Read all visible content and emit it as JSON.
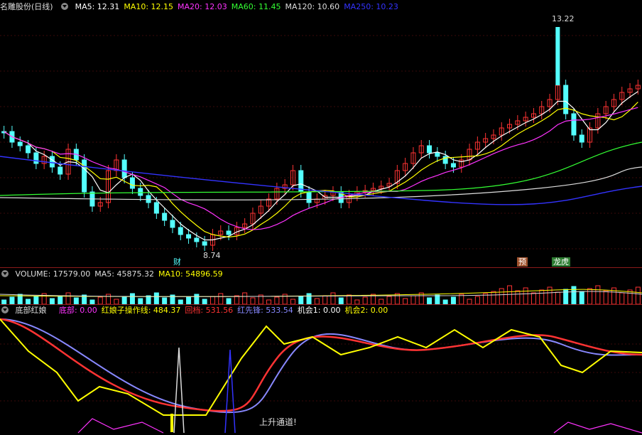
{
  "price_header": {
    "name": "名雕股份(日线)",
    "ma": [
      {
        "text": "MA5: 12.31",
        "color": "#ffffff"
      },
      {
        "text": "MA10: 12.15",
        "color": "#ffff00"
      },
      {
        "text": "MA20: 12.03",
        "color": "#ff33ff"
      },
      {
        "text": "MA60: 11.45",
        "color": "#33ff33"
      },
      {
        "text": "MA120: 10.60",
        "color": "#dddddd"
      },
      {
        "text": "MA250: 10.23",
        "color": "#3333ff"
      }
    ]
  },
  "price_labels": {
    "high": "13.22",
    "low": "8.74"
  },
  "event_tags": {
    "cai": "财",
    "yu": "预",
    "longhu": "龙虎"
  },
  "volume_header": {
    "items": [
      {
        "text": "VOLUME: 17579.00",
        "color": "#dddddd"
      },
      {
        "text": "MA5: 45875.32",
        "color": "#dddddd"
      },
      {
        "text": "MA10: 54896.59",
        "color": "#ffff00"
      }
    ]
  },
  "indicator_header": {
    "name": "底部红娘",
    "items": [
      {
        "text": "底部: 0.00",
        "color": "#ff33ff"
      },
      {
        "text": "红娘子操作线: 484.37",
        "color": "#ffff00"
      },
      {
        "text": "回档: 531.56",
        "color": "#ff3333"
      },
      {
        "text": "红先锋: 533.54",
        "color": "#8888ff"
      },
      {
        "text": "机会1: 0.00",
        "color": "#ffffff"
      },
      {
        "text": "机会2: 0.00",
        "color": "#ffff00"
      }
    ]
  },
  "indicator_note": "上升通道!",
  "colors": {
    "up": "#ff3333",
    "down": "#54ffff",
    "separator": "#8b1a1a"
  }
}
